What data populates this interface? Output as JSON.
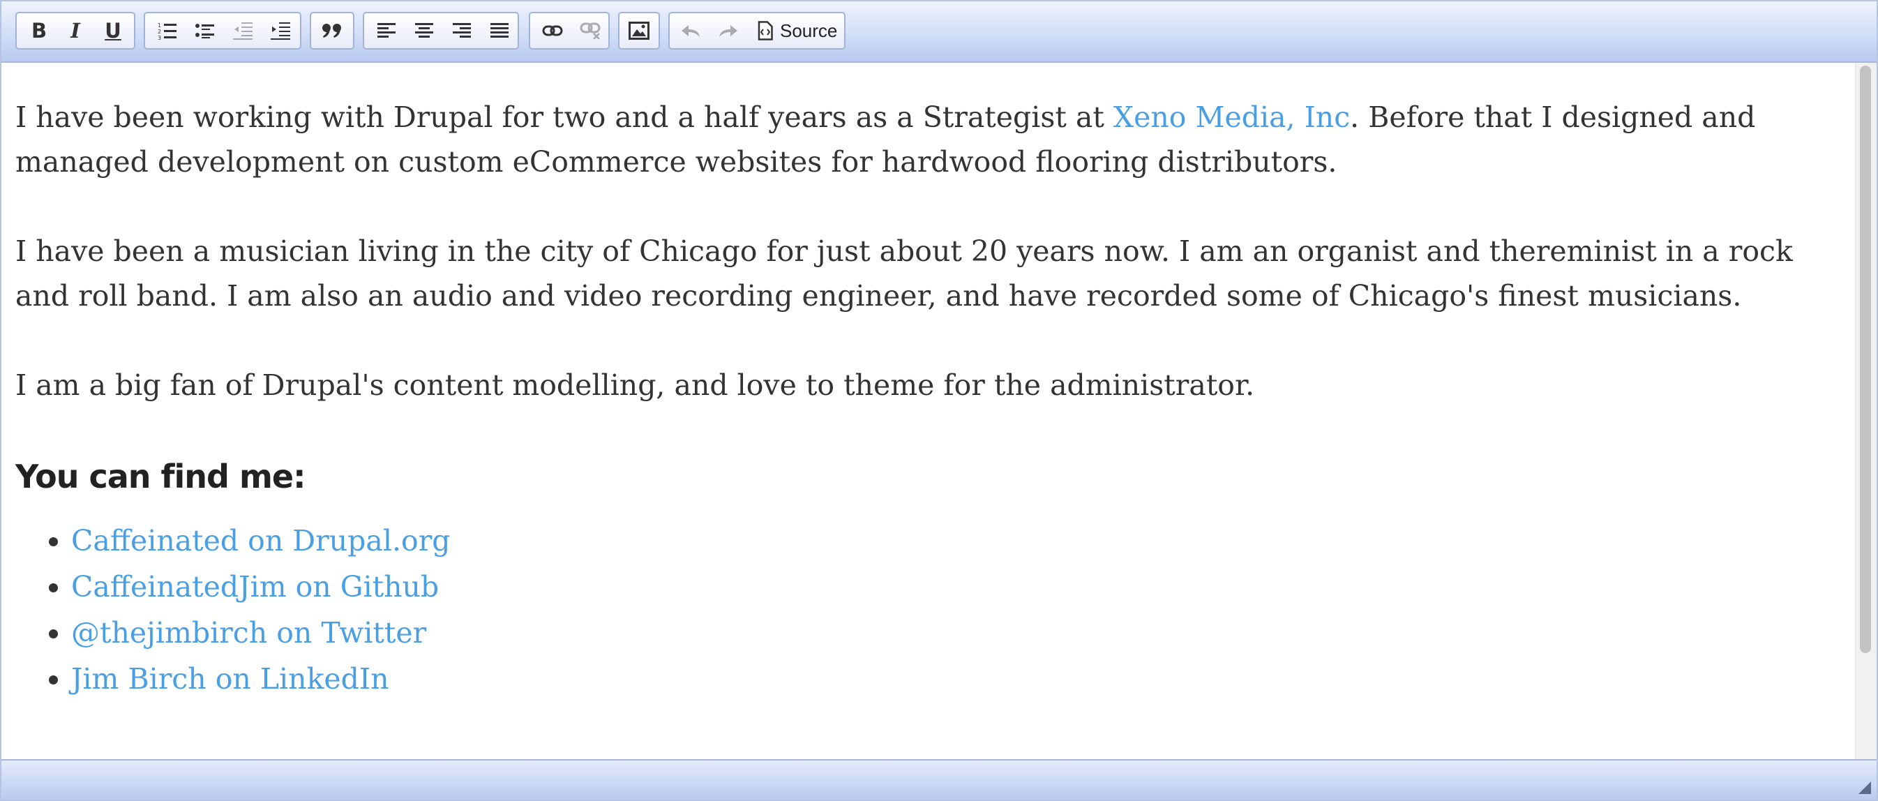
{
  "toolbar": {
    "bold_label": "B",
    "italic_label": "I",
    "underline_label": "U",
    "source_label": "Source",
    "icons": [
      "bold-icon",
      "italic-icon",
      "underline-icon",
      "numbered-list-icon",
      "bulleted-list-icon",
      "outdent-icon",
      "indent-icon",
      "blockquote-icon",
      "align-left-icon",
      "align-center-icon",
      "align-right-icon",
      "justify-icon",
      "link-icon",
      "unlink-icon",
      "image-icon",
      "undo-icon",
      "redo-icon",
      "source-icon"
    ]
  },
  "content": {
    "paragraphs": [
      {
        "before": "I have been working with Drupal for two and a half years as a Strategist at ",
        "link": "Xeno Media, Inc",
        "after": ". Before that I designed and managed development on custom eCommerce websites for hardwood flooring distributors."
      },
      {
        "text": "I have been a musician living in the city of Chicago for just about 20 years now. I am an organist and thereminist in a rock and roll band. I am also an audio and video recording engineer, and have recorded some of Chicago's finest musicians."
      },
      {
        "text": "I am a big fan of Drupal's content modelling, and love to theme for the administrator."
      }
    ],
    "heading": "You can find me:",
    "links": [
      "Caffeinated on Drupal.org",
      "CaffeinatedJim on Github",
      "@thejimbirch on Twitter",
      "Jim Birch on LinkedIn"
    ]
  },
  "colors": {
    "link": "#4a9fe4",
    "text": "#333333",
    "toolbar_top": "#eef3fd",
    "toolbar_bottom": "#b8caf0",
    "border": "#a7b8de"
  }
}
